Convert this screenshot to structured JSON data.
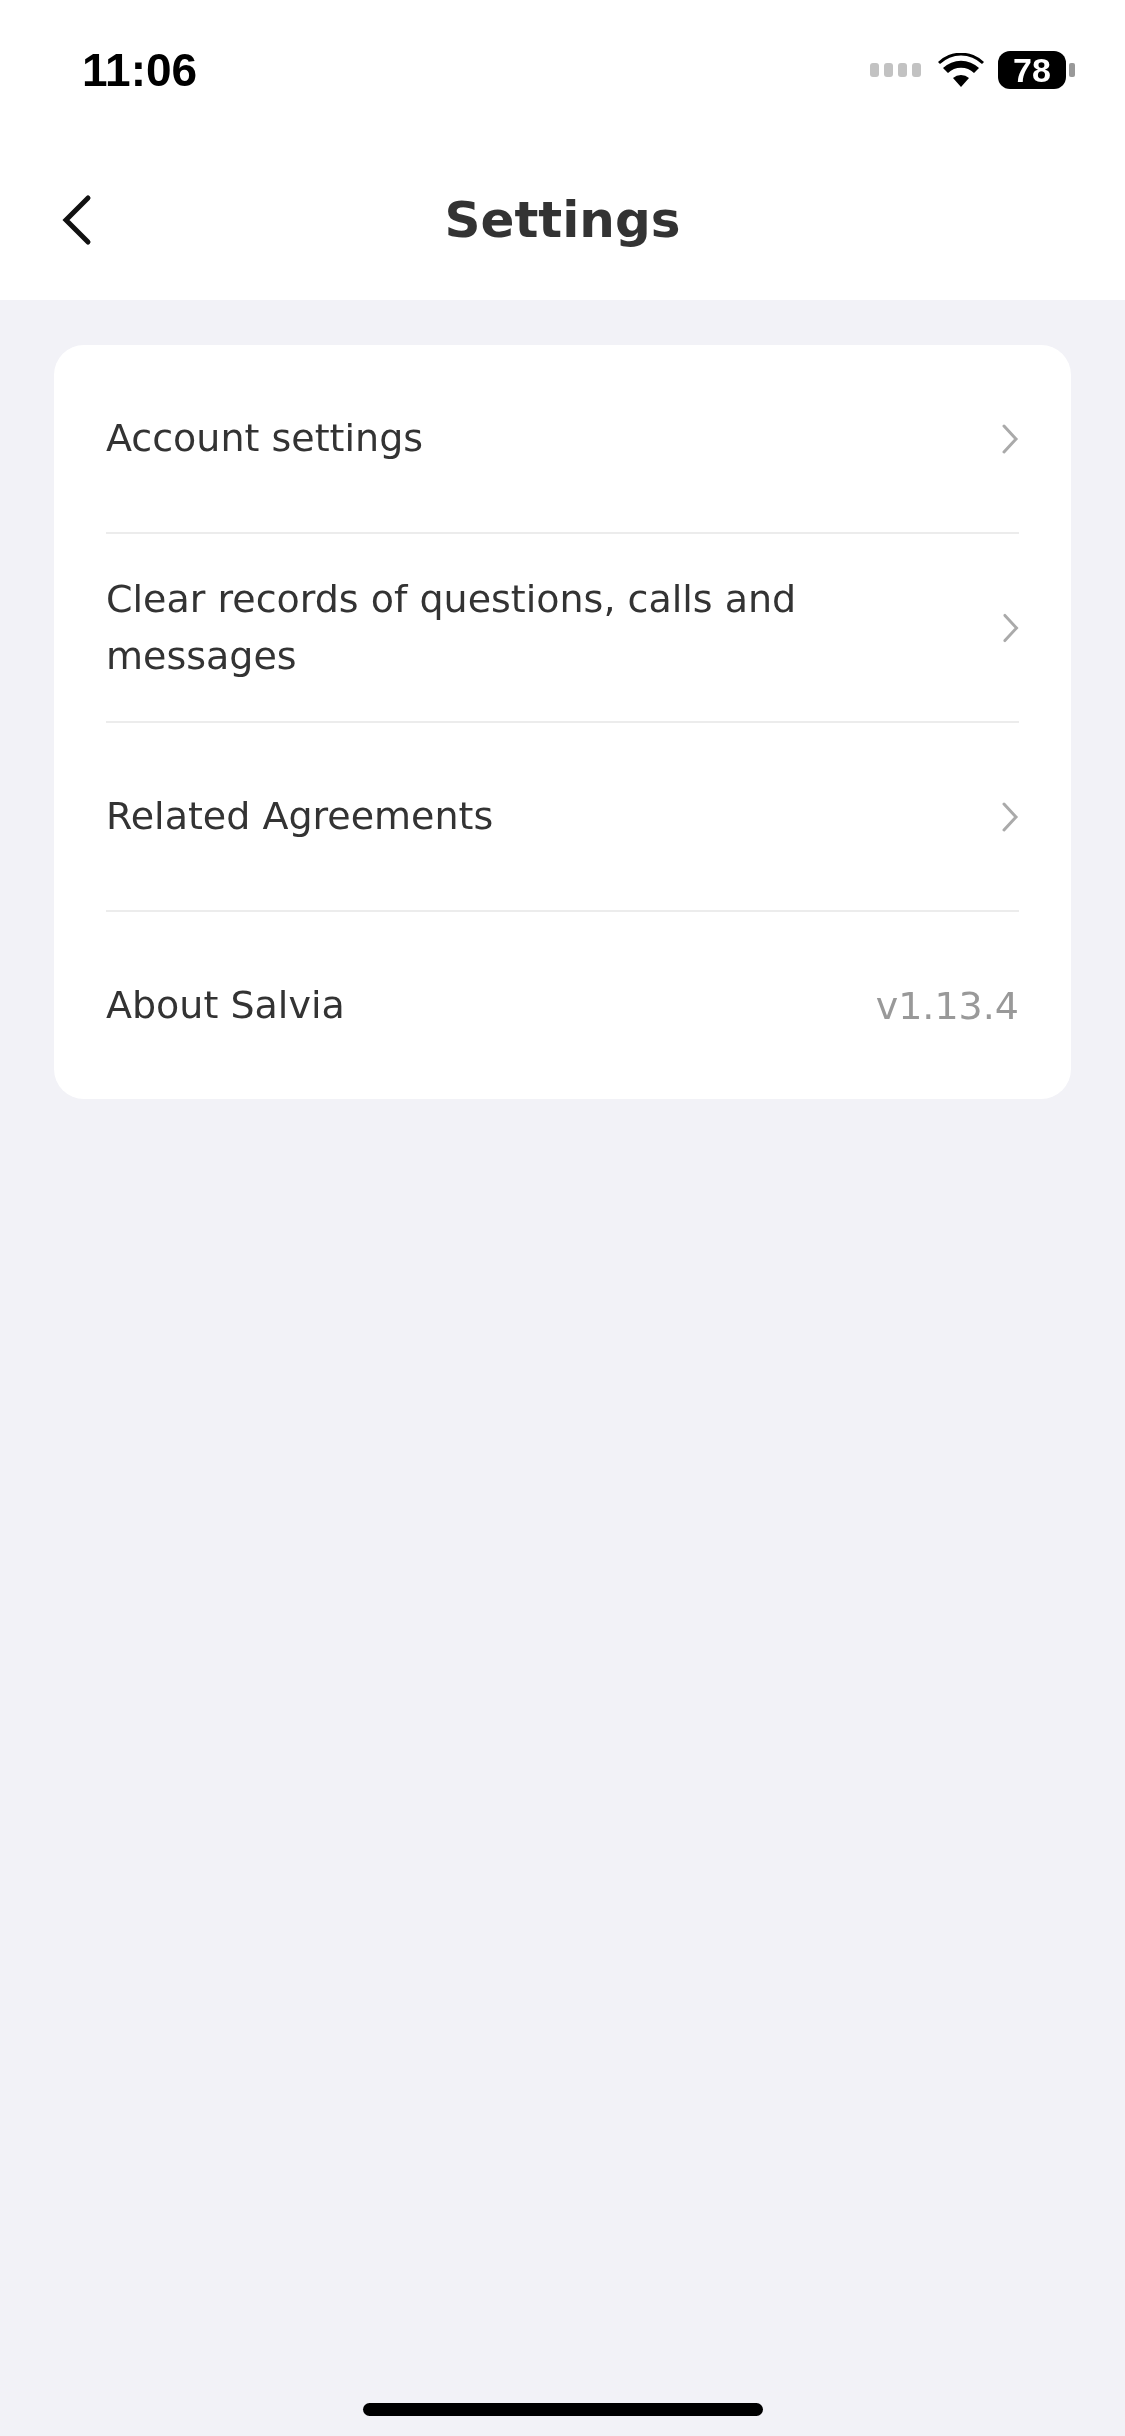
{
  "status_bar": {
    "time": "11:06",
    "battery": "78"
  },
  "header": {
    "title": "Settings"
  },
  "items": [
    {
      "kind": "link",
      "label": "Account settings"
    },
    {
      "kind": "link",
      "label": "Clear records of questions, calls and messages"
    },
    {
      "kind": "link",
      "label": "Related Agreements"
    },
    {
      "kind": "value",
      "label": "About Salvia",
      "value": "v1.13.4"
    }
  ]
}
